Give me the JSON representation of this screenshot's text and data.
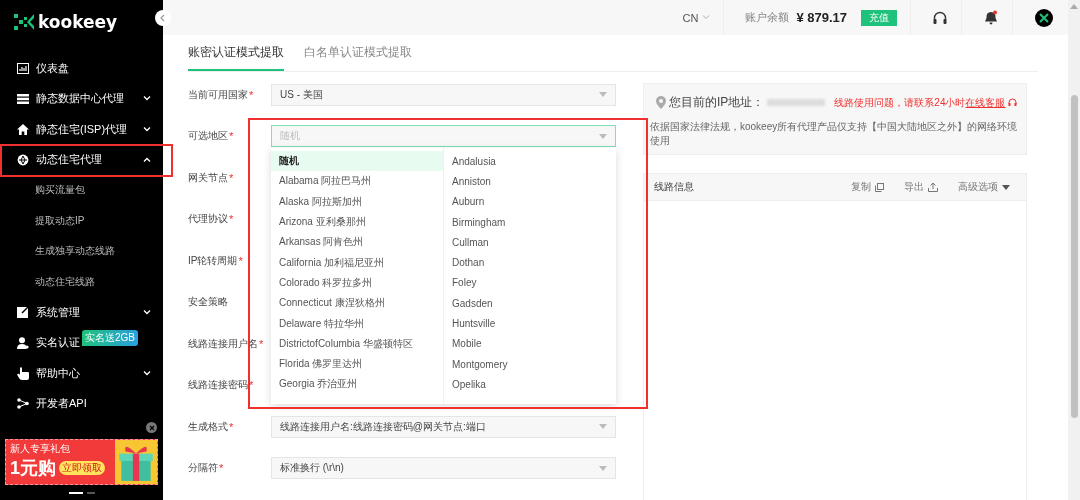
{
  "sidebar": {
    "logo": "kookeey",
    "items": [
      {
        "label": "仪表盘",
        "kind": "link",
        "expanded": false,
        "highlighted": false
      },
      {
        "label": "静态数据中心代理",
        "kind": "group",
        "expanded": false,
        "highlighted": false
      },
      {
        "label": "静态住宅(ISP)代理",
        "kind": "group",
        "expanded": false,
        "highlighted": false
      },
      {
        "label": "动态住宅代理",
        "kind": "group",
        "expanded": true,
        "highlighted": true,
        "children": [
          {
            "label": "购买流量包"
          },
          {
            "label": "提取动态IP"
          },
          {
            "label": "生成独享动态线路"
          },
          {
            "label": "动态住宅线路"
          }
        ]
      },
      {
        "label": "系统管理",
        "kind": "group",
        "expanded": false,
        "highlighted": false
      },
      {
        "label": "实名认证",
        "kind": "link",
        "expanded": false,
        "highlighted": false,
        "badge": "实名送2GB"
      },
      {
        "label": "帮助中心",
        "kind": "group",
        "expanded": false,
        "highlighted": false
      },
      {
        "label": "开发者API",
        "kind": "link",
        "expanded": false,
        "highlighted": false
      }
    ],
    "banner": {
      "title": "新人专享礼包",
      "price": "1元购",
      "button": "立即领取"
    },
    "slides": [
      {
        "selected": true
      },
      {
        "selected": false
      }
    ]
  },
  "topbar": {
    "language": "CN",
    "balance_label": "账户余额",
    "balance": "¥ 879.17",
    "recharge": "充值",
    "unread_notifications": true
  },
  "tabs": [
    {
      "label": "账密认证模式提取",
      "selected": true
    },
    {
      "label": "白名单认证模式提取",
      "selected": false
    }
  ],
  "required_mark": "*",
  "form": [
    {
      "label": "当前可用国家",
      "required": true,
      "value": "US - 美国",
      "focused": false
    },
    {
      "label": "可选地区",
      "required": true,
      "placeholder": "随机",
      "focused": true
    },
    {
      "label": "网关节点",
      "required": true
    },
    {
      "label": "代理协议",
      "required": true
    },
    {
      "label": "IP轮转周期",
      "required": true
    },
    {
      "label": "安全策略",
      "required": false
    },
    {
      "label": "线路连接用户名",
      "required": true
    },
    {
      "label": "线路连接密码",
      "required": true
    },
    {
      "label": "生成格式",
      "required": true,
      "value": "线路连接用户名:线路连接密码@网关节点:端口",
      "focused": false
    },
    {
      "label": "分隔符",
      "required": true,
      "value": "标准换行 (\\r\\n)",
      "focused": false
    }
  ],
  "region_dropdown": {
    "highlighted": true,
    "states": [
      {
        "label": "随机",
        "selected": true
      },
      {
        "label": "Alabama 阿拉巴马州",
        "selected": false
      },
      {
        "label": "Alaska 阿拉斯加州",
        "selected": false
      },
      {
        "label": "Arizona 亚利桑那州",
        "selected": false
      },
      {
        "label": "Arkansas 阿肯色州",
        "selected": false
      },
      {
        "label": "California 加利福尼亚州",
        "selected": false
      },
      {
        "label": "Colorado 科罗拉多州",
        "selected": false
      },
      {
        "label": "Connecticut 康涅狄格州",
        "selected": false
      },
      {
        "label": "Delaware 特拉华州",
        "selected": false
      },
      {
        "label": "DistrictofColumbia 华盛顿特区",
        "selected": false
      },
      {
        "label": "Florida 佛罗里达州",
        "selected": false
      },
      {
        "label": "Georgia 乔治亚州",
        "selected": false
      }
    ],
    "cities": [
      {
        "label": "Andalusia",
        "selected": false
      },
      {
        "label": "Anniston",
        "selected": false
      },
      {
        "label": "Auburn",
        "selected": false
      },
      {
        "label": "Birmingham",
        "selected": false
      },
      {
        "label": "Cullman",
        "selected": false
      },
      {
        "label": "Dothan",
        "selected": false
      },
      {
        "label": "Foley",
        "selected": false
      },
      {
        "label": "Gadsden",
        "selected": false
      },
      {
        "label": "Huntsville",
        "selected": false
      },
      {
        "label": "Mobile",
        "selected": false
      },
      {
        "label": "Montgomery",
        "selected": false
      },
      {
        "label": "Opelika",
        "selected": false
      }
    ]
  },
  "ip_panel": {
    "title": "您目前的IP地址：",
    "notice": "线路使用问题，请联系24小时",
    "notice_link": "在线客服",
    "description": "依据国家法律法规，kookeey所有代理产品仅支持【中国大陆地区之外】的网络环境使用"
  },
  "routes_panel": {
    "title": "线路信息",
    "actions": [
      {
        "label": "复制",
        "kind": "copy"
      },
      {
        "label": "导出",
        "kind": "export"
      },
      {
        "label": "高级选项",
        "kind": "menu"
      }
    ]
  }
}
